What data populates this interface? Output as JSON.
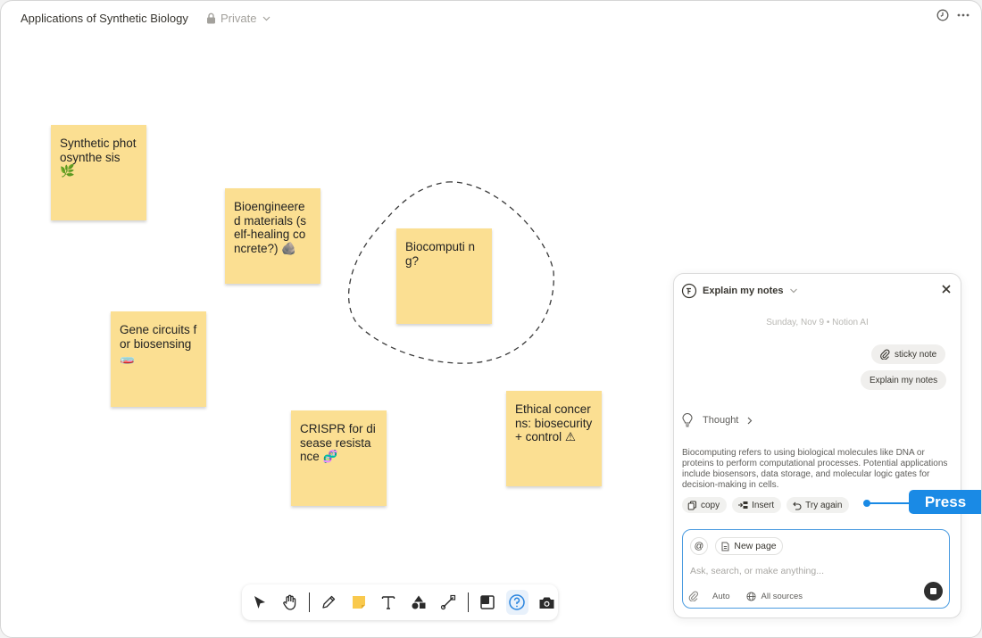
{
  "header": {
    "title": "Applications of Synthetic Biology",
    "privacy_label": "Private"
  },
  "notes": [
    {
      "text": "Synthetic photosynthe sis 🌿"
    },
    {
      "text": "Bioengineered materials (self-healing concrete?) 🪨"
    },
    {
      "text": "Biocomputi ng?"
    },
    {
      "text": "Gene circuits for biosensing 🧫"
    },
    {
      "text": "CRISPR for disease resistance 🧬"
    },
    {
      "text": "Ethical concerns: biosecurity + control ⚠"
    }
  ],
  "toolbar": {
    "tools": [
      "select",
      "hand",
      "pen",
      "sticky-note",
      "text",
      "shapes",
      "connector",
      "frame",
      "help",
      "screenshot"
    ]
  },
  "ai_panel": {
    "title": "Explain my notes",
    "date_line": "Sunday, Nov 9 • Notion AI",
    "attachment_chip": "sticky note",
    "user_message": "Explain my notes",
    "thought_label": "Thought",
    "answer": "Biocomputing refers to using biological molecules like DNA or proteins to perform computational processes. Potential applications include biosensors, data storage, and molecular logic gates for decision-making in cells.",
    "actions": {
      "copy": "copy",
      "insert": "Insert",
      "try_again": "Try again"
    },
    "composer": {
      "mention_symbol": "@",
      "new_page_label": "New page",
      "placeholder": "Ask, search, or make anything...",
      "mode": "Auto",
      "sources": "All sources"
    }
  },
  "callout": {
    "label": "Press"
  },
  "colors": {
    "sticky_note": "#fbdf92",
    "accent_blue": "#1a8ae5",
    "composer_border": "#4a9be0"
  }
}
